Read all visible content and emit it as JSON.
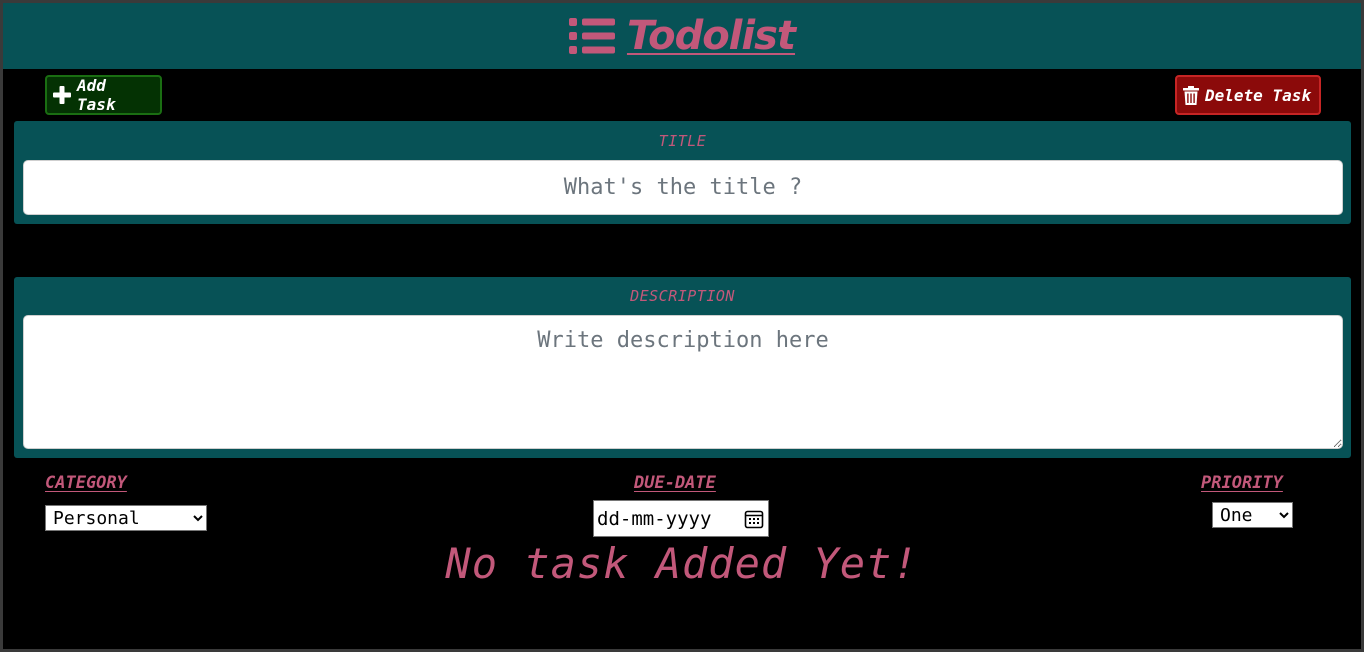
{
  "header": {
    "title": "Todolist",
    "icon": "list-icon",
    "background": "#075256",
    "title_color": "#c2587a"
  },
  "toolbar": {
    "add_label": "Add Task",
    "add_icon": "plus-icon",
    "delete_label": "Delete Task",
    "delete_icon": "trash-icon"
  },
  "form": {
    "title_label": "TITLE",
    "title_placeholder": "What's the title ?",
    "title_value": "",
    "description_label": "DESCRIPTION",
    "description_placeholder": "Write description here",
    "description_value": "",
    "category_label": "CATEGORY",
    "category_selected": "Personal",
    "due_date_label": "DUE-DATE",
    "due_date_placeholder": "dd-mm-yyyy",
    "due_date_icon": "calendar-icon",
    "priority_label": "PRIORITY",
    "priority_selected": "One"
  },
  "tasks": {
    "empty_message": "No task Added Yet!"
  },
  "colors": {
    "accent": "#c2587a",
    "panel": "#075256",
    "add_button": "#043203",
    "delete_button": "#8b0a0a"
  }
}
